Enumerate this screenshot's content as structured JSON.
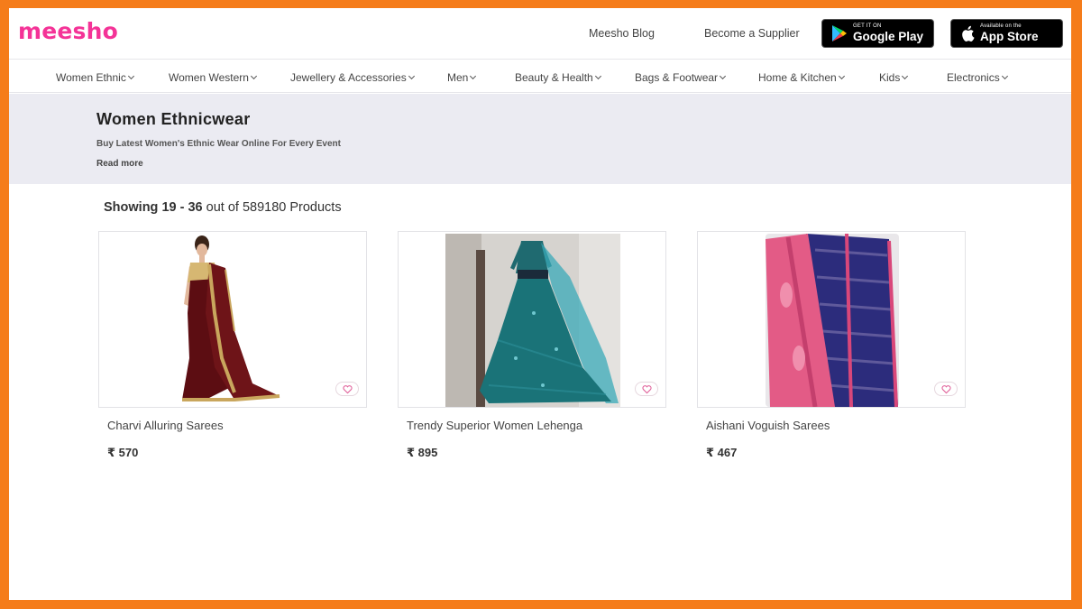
{
  "header": {
    "logo": "meesho",
    "links": [
      "Meesho Blog",
      "Become a Supplier"
    ],
    "google_play": {
      "small": "GET IT ON",
      "big": "Google Play"
    },
    "app_store": {
      "small": "Available on the",
      "big": "App Store"
    }
  },
  "categories": [
    "Women Ethnic",
    "Women Western",
    "Jewellery & Accessories",
    "Men",
    "Beauty & Health",
    "Bags & Footwear",
    "Home & Kitchen",
    "Kids",
    "Electronics"
  ],
  "banner": {
    "title": "Women Ethnicwear",
    "subtitle": "Buy Latest Women's Ethnic Wear Online For Every Event",
    "read_more": "Read more"
  },
  "results": {
    "prefix": "Showing",
    "range": "19 - 36",
    "suffix": "out of 589180 Products"
  },
  "products": [
    {
      "name": "Charvi Alluring Sarees",
      "price": "₹ 570"
    },
    {
      "name": "Trendy Superior Women Lehenga",
      "price": "₹ 895"
    },
    {
      "name": "Aishani Voguish Sarees",
      "price": "₹ 467"
    }
  ],
  "colors": {
    "brand": "#f43397",
    "frame": "#f57c1a",
    "banner_bg": "#ebebf2"
  }
}
